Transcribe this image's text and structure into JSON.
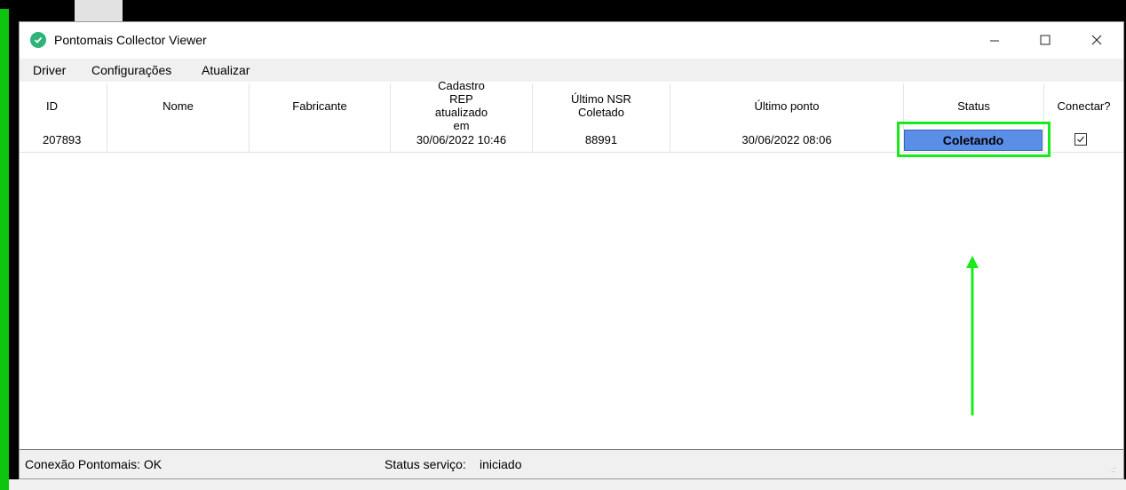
{
  "window": {
    "title": "Pontomais Collector Viewer",
    "controls": {
      "minimize": "–",
      "maximize": "☐",
      "close": "✕"
    }
  },
  "menu": {
    "items": [
      "Driver",
      "Configurações",
      "Atualizar"
    ]
  },
  "table": {
    "columns": [
      "ID",
      "Nome",
      "Fabricante",
      "Cadastro REP atualizado em",
      "Último NSR Coletado",
      "Último ponto",
      "Status",
      "Conectar?"
    ],
    "rows": [
      {
        "id": "207893",
        "nome": "",
        "fabricante": "",
        "cadastro": "30/06/2022 10:46",
        "nsr": "88991",
        "ultimo_ponto": "30/06/2022 08:06",
        "status": "Coletando",
        "conectar": true
      }
    ]
  },
  "statusbar": {
    "conexao": "Conexão Pontomais: OK",
    "servico_label": "Status serviço:",
    "servico_value": "iniciado"
  },
  "colors": {
    "status_button": "#5b8ee6",
    "highlight": "#19ea19",
    "app_icon": "#2fb37a"
  },
  "icons": {
    "app": "check-circle-icon",
    "annotation_arrow": "arrow-up-icon"
  }
}
